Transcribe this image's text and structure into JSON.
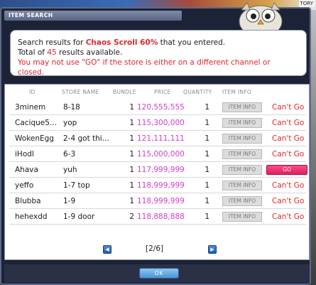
{
  "window": {
    "title": "ITEM SEARCH",
    "corner_tab": "TORY"
  },
  "message": {
    "line1_prefix": "Search results for ",
    "item_name": "Chaos Scroll 60%",
    "line1_suffix": " that you entered.",
    "line2_prefix": "Total of ",
    "count": "45",
    "line2_suffix": " results available.",
    "warning": "You may not use \"GO\" if the store is either on a different channel or closed."
  },
  "table": {
    "headers": {
      "id": "ID",
      "store": "STORE NAME",
      "bundle": "BUNDLE",
      "price": "PRICE",
      "quantity": "QUANTITY",
      "info": "ITEM INFO"
    },
    "rows": [
      {
        "id": "3minem",
        "store": "8-18",
        "bundle": "1",
        "price": "120,555,555",
        "qty": "1",
        "info": "ITEM INFO",
        "go": "Can't Go",
        "can_go": false
      },
      {
        "id": "Cacique5...",
        "store": "yop",
        "bundle": "1",
        "price": "115,300,000",
        "qty": "1",
        "info": "ITEM INFO",
        "go": "Can't Go",
        "can_go": false
      },
      {
        "id": "WokenEgg",
        "store": "2-4 got thi...",
        "bundle": "1",
        "price": "121,111,111",
        "qty": "1",
        "info": "ITEM INFO",
        "go": "Can't Go",
        "can_go": false
      },
      {
        "id": "iHodl",
        "store": "6-3",
        "bundle": "1",
        "price": "115,000,000",
        "qty": "1",
        "info": "ITEM INFO",
        "go": "Can't Go",
        "can_go": false
      },
      {
        "id": "Ahava",
        "store": "yuh",
        "bundle": "1",
        "price": "117,999,999",
        "qty": "1",
        "info": "ITEM INFO",
        "go": "GO",
        "can_go": true
      },
      {
        "id": "yeffo",
        "store": "1-7 top",
        "bundle": "1",
        "price": "118,999,999",
        "qty": "1",
        "info": "ITEM INFO",
        "go": "Can't Go",
        "can_go": false
      },
      {
        "id": "Blubba",
        "store": "1-9",
        "bundle": "1",
        "price": "118,999,999",
        "qty": "1",
        "info": "ITEM INFO",
        "go": "Can't Go",
        "can_go": false
      },
      {
        "id": "hehexdd",
        "store": "1-9 door",
        "bundle": "2",
        "price": "118,888,888",
        "qty": "1",
        "info": "ITEM INFO",
        "go": "Can't Go",
        "can_go": false
      }
    ]
  },
  "pager": {
    "label": "[2/6]",
    "prev_icon": "left-arrow-icon",
    "next_icon": "right-arrow-icon"
  },
  "footer": {
    "ok_label": "OK"
  },
  "colors": {
    "price": "#d13ed0",
    "warning": "#e0262b",
    "go_button": "#e0205c"
  }
}
